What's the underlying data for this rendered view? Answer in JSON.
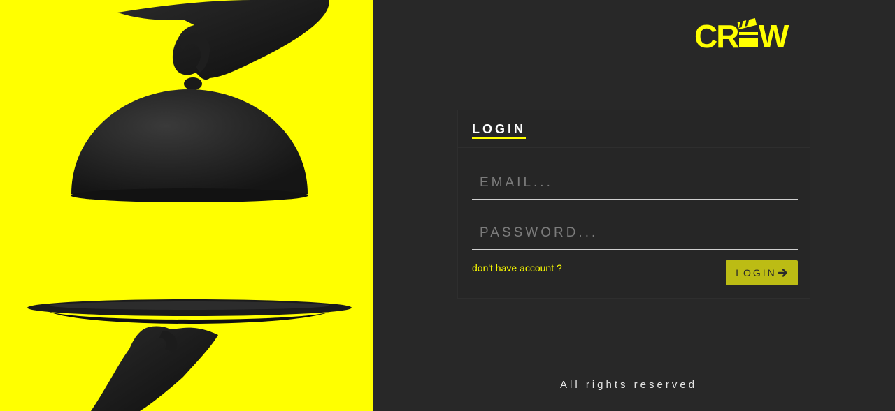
{
  "brand": {
    "logo_text": "CREW",
    "accent_color": "#ffff00",
    "background_color": "#282828"
  },
  "login_card": {
    "title": "LOGIN",
    "email_placeholder": "EMAIL...",
    "password_placeholder": "PASSWORD...",
    "signup_link": "don't have account ?",
    "login_button": "LOGIN"
  },
  "icons": {
    "login_arrow": "arrow-right-icon",
    "illustration": "cloche-and-tray-illustration"
  },
  "footer": {
    "text": "All rights reserved"
  }
}
